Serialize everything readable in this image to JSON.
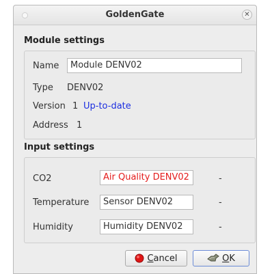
{
  "window": {
    "title": "GoldenGate"
  },
  "module": {
    "section_title": "Module settings",
    "name_label": "Name",
    "name_value": "Module DENV02",
    "type_label": "Type",
    "type_value": "DENV02",
    "version_label": "Version",
    "version_value": "1",
    "version_status": "Up-to-date",
    "address_label": "Address",
    "address_value": "1"
  },
  "inputs": {
    "section_title": "Input settings",
    "rows": [
      {
        "label": "CO2",
        "value": "Air Quality DENV02",
        "status": "-",
        "value_color": "#e41b1b"
      },
      {
        "label": "Temperature",
        "value": "Sensor DENV02",
        "status": "-"
      },
      {
        "label": "Humidity",
        "value": "Humidity DENV02",
        "status": "-"
      }
    ]
  },
  "buttons": {
    "cancel_prefix": "",
    "cancel_u": "C",
    "cancel_rest": "ancel",
    "ok_u": "O",
    "ok_rest": "K"
  },
  "icons": {
    "close": "close-icon",
    "cancel": "cancel-icon",
    "ok": "ok-icon"
  }
}
